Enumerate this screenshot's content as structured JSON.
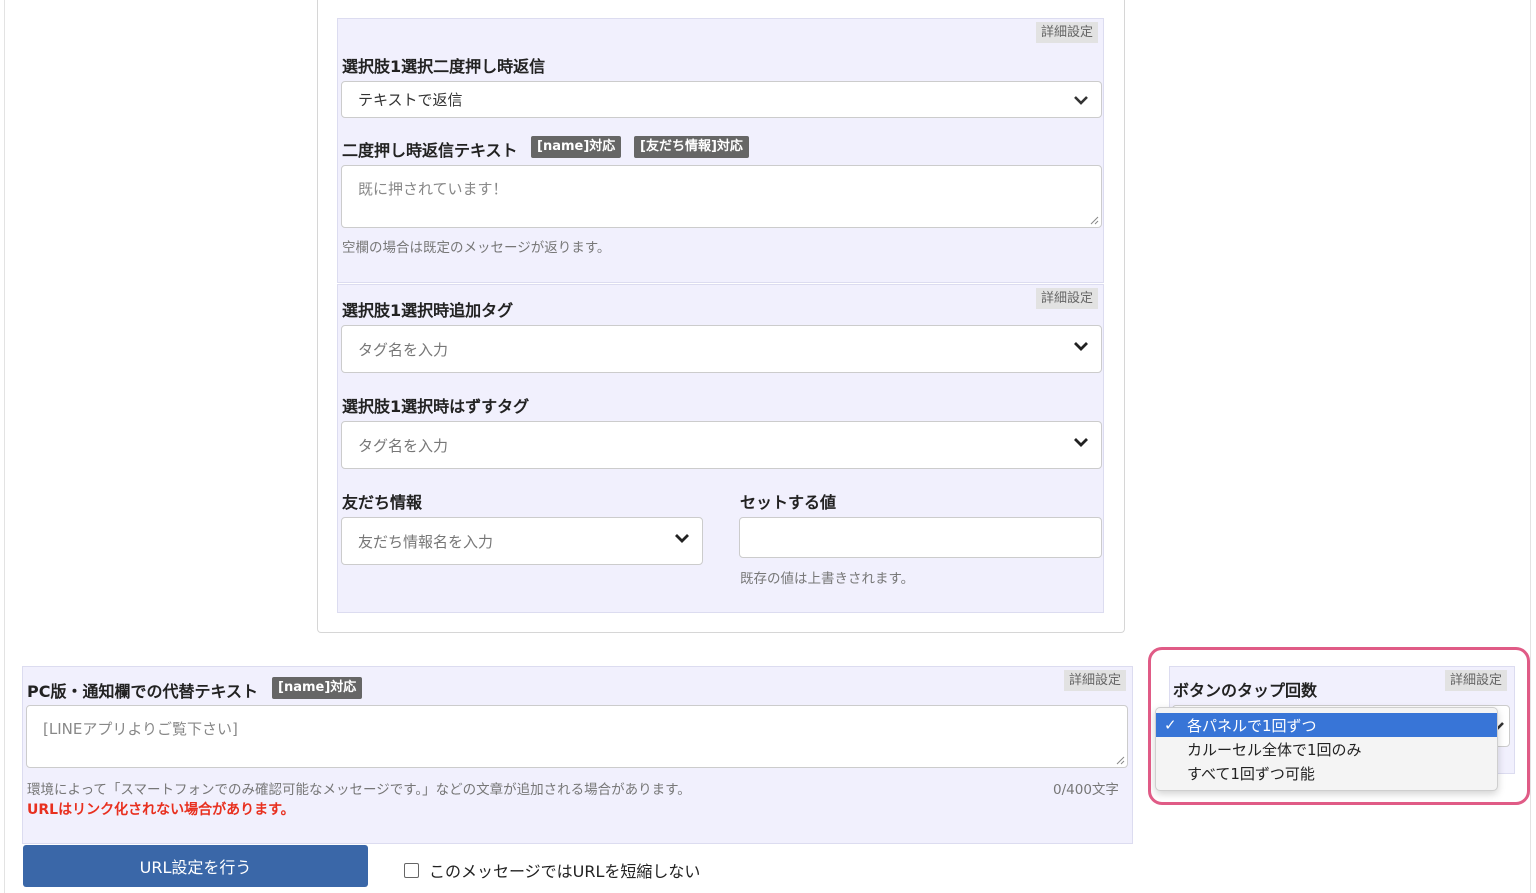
{
  "detail_label": "詳細設定",
  "reply_section": {
    "label": "選択肢1選択二度押し時返信",
    "select_value": "テキストで返信"
  },
  "double_press": {
    "label": "二度押し時返信テキスト",
    "tag_name": "[name]対応",
    "tag_friend": "[友だち情報]対応",
    "placeholder": "既に押されています！",
    "help": "空欄の場合は既定のメッセージが返ります。"
  },
  "tag_section": {
    "add_label": "選択肢1選択時追加タグ",
    "add_placeholder": "タグ名を入力",
    "remove_label": "選択肢1選択時はずすタグ",
    "remove_placeholder": "タグ名を入力",
    "friend_label": "友だち情報",
    "friend_placeholder": "友だち情報名を入力",
    "value_label": "セットする値",
    "value_value": "",
    "value_help": "既存の値は上書きされます。"
  },
  "alt_text": {
    "label": "PC版・通知欄での代替テキスト",
    "tag_name": "[name]対応",
    "placeholder": "[LINEアプリよりご覧下さい]",
    "help": "環境によって「スマートフォンでのみ確認可能なメッセージです。」などの文章が追加される場合があります。",
    "counter": "0/400文字",
    "warning": "URLはリンク化されない場合があります。"
  },
  "tap_count": {
    "label": "ボタンのタップ回数",
    "check": "✓",
    "options": [
      "各パネルで1回ずつ",
      "カルーセル全体で1回のみ",
      "すべて1回ずつ可能"
    ]
  },
  "url": {
    "button_label": "URL設定を行う",
    "checkbox_label": "このメッセージではURLを短縮しない"
  },
  "colors": {
    "panel_bg": "#f1f0fd",
    "button_bg": "#3a67a8",
    "warning": "#e8301f",
    "highlight": "#e05b86",
    "selected": "#3875d7"
  }
}
